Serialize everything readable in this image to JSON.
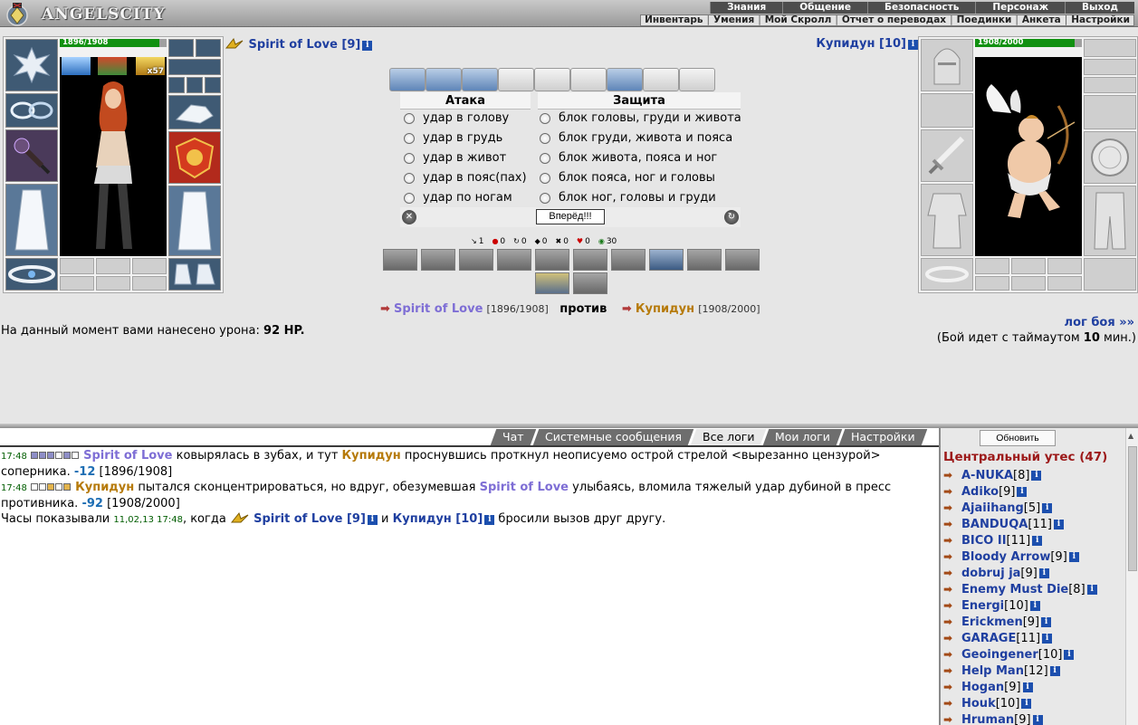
{
  "header": {
    "logo": "ANGELSCITY",
    "main_nav": [
      "Знания",
      "Общение",
      "Безопасность",
      "Персонаж",
      "Выход"
    ],
    "sub_nav": [
      "Инвентарь",
      "Умения",
      "Мой Скролл",
      "Отчет о переводах",
      "Поединки",
      "Анкета",
      "Настройки"
    ]
  },
  "player": {
    "name": "Spirit of Love [9]",
    "hp": "1896/1908",
    "buff_count": "x57"
  },
  "opponent": {
    "name": "Купидун [10]",
    "hp": "1908/2000"
  },
  "combat": {
    "attack_title": "Атака",
    "defense_title": "Защита",
    "attacks": [
      "удар в голову",
      "удар в грудь",
      "удар в живот",
      "удар в пояс(пах)",
      "удар по ногам"
    ],
    "defenses": [
      "блок головы, груди и живота",
      "блок груди, живота и пояса",
      "блок живота, пояса и ног",
      "блок пояса, ног и головы",
      "блок ног, головы и груди"
    ],
    "forward_button": "Вперёд!!!",
    "counters": [
      "1",
      "0",
      "0",
      "0",
      "0",
      "0",
      "30"
    ]
  },
  "vs_line": {
    "p1": "Spirit of Love",
    "p1_hp": "[1896/1908]",
    "vs": "против",
    "p2": "Купидун",
    "p2_hp": "[1908/2000]"
  },
  "damage": {
    "prefix": "На данный момент вами нанесено урона:",
    "value": "92 HP."
  },
  "log_link": "лог боя »»",
  "timeout": {
    "prefix": "(Бой идет с таймаутом",
    "value": "10",
    "suffix": "мин.)"
  },
  "tabs": [
    "Чат",
    "Системные сообщения",
    "Все логи",
    "Мои логи",
    "Настройки"
  ],
  "log": {
    "l1_time": "17:48",
    "l1_p1": "Spirit of Love",
    "l1_text1": "ковырялась в зубах, и тут",
    "l1_p2": "Купидун",
    "l1_text2": "проснувшись проткнул неописуемо острой стрелой <вырезанно цензурой> соперника.",
    "l1_dmg": "-12",
    "l1_hp": "[1896/1908]",
    "l2_time": "17:48",
    "l2_p2": "Купидун",
    "l2_text1": "пытался сконцентрироваться, но вдруг, обезумевшая",
    "l2_p1": "Spirit of Love",
    "l2_text2": "улыбаясь, вломила тяжелый удар дубиной в пресс противника.",
    "l2_dmg": "-92",
    "l2_hp": "[1908/2000]",
    "l3_text1": "Часы показывали",
    "l3_time": "11,02,13 17:48",
    "l3_text2": ", когда",
    "l3_p1": "Spirit of Love [9]",
    "l3_and": "и",
    "l3_p2": "Купидун [10]",
    "l3_text3": "бросили вызов друг другу."
  },
  "sidebar": {
    "refresh": "Обновить",
    "location": "Центральный утес (47)",
    "users": [
      {
        "name": "A-NUKA",
        "level": "[8]"
      },
      {
        "name": "Adiko",
        "level": "[9]"
      },
      {
        "name": "Ajaiihang",
        "level": "[5]"
      },
      {
        "name": "BANDUQA",
        "level": "[11]"
      },
      {
        "name": "BICO II",
        "level": "[11]"
      },
      {
        "name": "Bloody Arrow",
        "level": "[9]"
      },
      {
        "name": "dobruj ja",
        "level": "[9]"
      },
      {
        "name": "Enemy Must Die",
        "level": "[8]"
      },
      {
        "name": "Energi",
        "level": "[10]"
      },
      {
        "name": "Erickmen",
        "level": "[9]"
      },
      {
        "name": "GARAGE",
        "level": "[11]"
      },
      {
        "name": "Geoingener",
        "level": "[10]"
      },
      {
        "name": "Help Man",
        "level": "[12]"
      },
      {
        "name": "Hogan",
        "level": "[9]"
      },
      {
        "name": "Houk",
        "level": "[10]"
      },
      {
        "name": "Hruman",
        "level": "[9]"
      }
    ]
  }
}
